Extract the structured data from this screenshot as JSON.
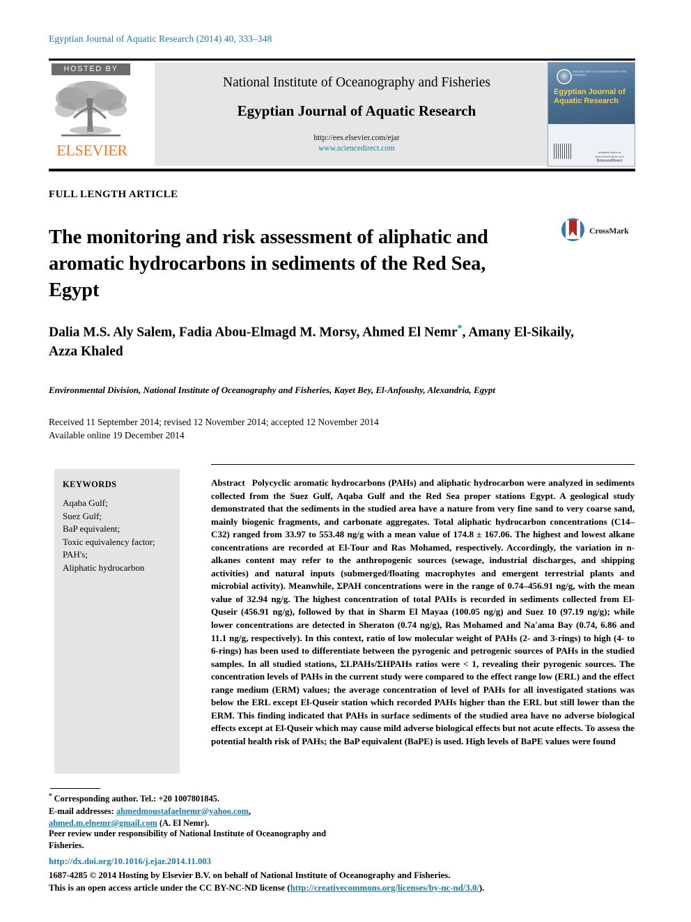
{
  "running_head": "Egyptian Journal of Aquatic Research (2014) 40, 333–348",
  "masthead": {
    "hosted_by": "HOSTED BY",
    "publisher": "ELSEVIER",
    "institute": "National Institute of Oceanography and Fisheries",
    "journal_title": "Egyptian Journal of Aquatic Research",
    "url_submission": "http://ees.elsevier.com/ejar",
    "url_sciencedirect": "www.sciencedirect.com",
    "cover": {
      "seal_caption": "NATIONAL INSTITUTE OCEANOGRAPHY AND FISHERIES",
      "title_line1": "Egyptian Journal of",
      "title_line2": "Aquatic Research",
      "foot_caption": "Available online at www.sciencedirect.com",
      "foot_brand": "ScienceDirect"
    }
  },
  "article": {
    "type": "FULL LENGTH ARTICLE",
    "title": "The monitoring and risk assessment of aliphatic and aromatic hydrocarbons in sediments of the Red Sea, Egypt",
    "crossmark_label": "CrossMark",
    "authors": "Dalia M.S. Aly Salem, Fadia Abou-Elmagd M. Morsy, Ahmed El Nemr",
    "authors_tail": ", Amany El-Sikaily, Azza Khaled",
    "corresponding_marker": "*",
    "affiliation": "Environmental Division, National Institute of Oceanography and Fisheries, Kayet Bey, El-Anfoushy, Alexandria, Egypt",
    "dates_line1": "Received 11 September 2014; revised 12 November 2014; accepted 12 November 2014",
    "dates_line2": "Available online 19 December 2014"
  },
  "keywords": {
    "heading": "KEYWORDS",
    "items": [
      "Aqaba Gulf;",
      "Suez Gulf;",
      "BaP equivalent;",
      "Toxic equivalency factor;",
      "PAH's;",
      "Aliphatic hydrocarbon"
    ]
  },
  "abstract": {
    "label": "Abstract",
    "text": "Polycyclic aromatic hydrocarbons (PAHs) and aliphatic hydrocarbon were analyzed in sediments collected from the Suez Gulf, Aqaba Gulf and the Red Sea proper stations Egypt. A geological study demonstrated that the sediments in the studied area have a nature from very fine sand to very coarse sand, mainly biogenic fragments, and carbonate aggregates. Total aliphatic hydrocarbon concentrations (C14–C32) ranged from 33.97 to 553.48 ng/g with a mean value of 174.8 ± 167.06. The highest and lowest alkane concentrations are recorded at El-Tour and Ras Mohamed, respectively. Accordingly, the variation in n-alkanes content may refer to the anthropogenic sources (sewage, industrial discharges, and shipping activities) and natural inputs (submerged/floating macrophytes and emergent terrestrial plants and microbial activity). Meanwhile, ΣPAH concentrations were in the range of 0.74–456.91 ng/g, with the mean value of 32.94 ng/g. The highest concentration of total PAHs is recorded in sediments collected from El-Quseir (456.91 ng/g), followed by that in Sharm El Mayaa (100.05 ng/g) and Suez 10 (97.19 ng/g); while lower concentrations are detected in Sheraton (0.74 ng/g), Ras Mohamed and Na'ama Bay (0.74, 6.86 and 11.1 ng/g, respectively). In this context, ratio of low molecular weight of PAHs (2- and 3-rings) to high (4- to 6-rings) has been used to differentiate between the pyrogenic and petrogenic sources of PAHs in the studied samples. In all studied stations, ΣLPAHs/ΣHPAHs ratios were < 1, revealing their pyrogenic sources. The concentration levels of PAHs in the current study were compared to the effect range low (ERL) and the effect range medium (ERM) values; the average concentration of level of PAHs for all investigated stations was below the ERL except El-Quseir station which recorded PAHs higher than the ERL but still lower than the ERM. This finding indicated that PAHs in surface sediments of the studied area have no adverse biological effects except at El-Quseir which may cause mild adverse biological effects but not acute effects. To assess the potential health risk of PAHs; the BaP equivalent (BaPE) is used. High levels of BaPE values were found"
  },
  "footnotes": {
    "corresponding": "Corresponding author. Tel.: +20 1007801845.",
    "email_label": "E-mail addresses:",
    "email1": "ahmedmoustafaelnemr@yahoo.com",
    "email2": "ahmed.m.elnemr@gmail.com",
    "email_attrib": "(A. El Nemr).",
    "peer_review": "Peer review under responsibility of National Institute of Oceanography and Fisheries."
  },
  "footer": {
    "doi": "http://dx.doi.org/10.1016/j.ejar.2014.11.003",
    "copyright": "1687-4285 © 2014 Hosting by Elsevier B.V. on behalf of National Institute of Oceanography and Fisheries.",
    "license_prefix": "This is an open access article under the CC BY-NC-ND license (",
    "license_url": "http://creativecommons.org/licenses/by-nc-nd/3.0/",
    "license_suffix": ")."
  },
  "colors": {
    "link": "#1a7ba8",
    "elsevier_orange": "#ec7c27",
    "cover_title_yellow": "#f2d14a",
    "crossmark_blue": "#3f77b5",
    "crossmark_red": "#b4251d",
    "panel_gray": "#e6e6e6"
  }
}
